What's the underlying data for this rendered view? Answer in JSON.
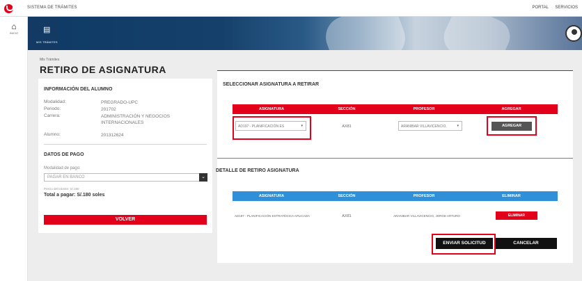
{
  "top": {
    "system_title": "SISTEMA DE TRÁMITES",
    "links": [
      "PORTAL",
      "SERVICIOS"
    ]
  },
  "rail": {
    "home_label": "INICIO"
  },
  "banner": {
    "tile_label": "MIS TRÁMITES"
  },
  "breadcrumb": "Mis Trámites",
  "page_title": "RETIRO DE ASIGNATURA",
  "student": {
    "heading": "INFORMACIÓN DEL ALUMNO",
    "fields": [
      {
        "label": "Modalidad:",
        "value": "PREGRADO-UPC"
      },
      {
        "label": "Periodo:",
        "value": "201702"
      },
      {
        "label": "Carrera:",
        "value": "ADMINISTRACIÓN Y NEGOCIOS INTERNACIONALES"
      },
      {
        "label": "Alumno:",
        "value": "201312624"
      }
    ]
  },
  "payment": {
    "heading": "DATOS DE PAGO",
    "mode_label": "Modalidad de pago:",
    "mode_value": "PAGAR EN BANCO",
    "fine_print": "Precio del trámite: S/.180",
    "total": "Total a pagar: S/.180 soles",
    "back_button": "VOLVER"
  },
  "select_section": {
    "heading": "SELECCIONAR ASIGNATURA A RETIRAR",
    "columns": [
      "ASIGNATURA",
      "SECCIÓN",
      "PROFESOR",
      "AGREGAR"
    ],
    "course_value": "AD197 - PLANIFICACIÓN ES",
    "section_value": "AX81",
    "professor_value": "ARANIBAR VILLAVICENCIO,",
    "add_button": "AGREGAR"
  },
  "detail_section": {
    "heading": "DETALLE DE RETIRO ASIGNATURA",
    "columns": [
      "ASIGNATURA",
      "SECCIÓN",
      "PROFESOR",
      "ELIMINAR"
    ],
    "rows": [
      {
        "course": "AD197 - PLANIFICACIÓN ESTRATÉGICA APLICADA",
        "section": "AX81",
        "professor": "ARANIBAR VILLAVICENCIO, JORGE ARTURO",
        "remove": "ELIMINAR"
      }
    ]
  },
  "actions": {
    "submit": "ENVIAR SOLICITUD",
    "cancel": "CANCELAR"
  },
  "colors": {
    "brand_red": "#e2001a",
    "accent_blue": "#2f8fd8",
    "navy": "#123a63"
  }
}
